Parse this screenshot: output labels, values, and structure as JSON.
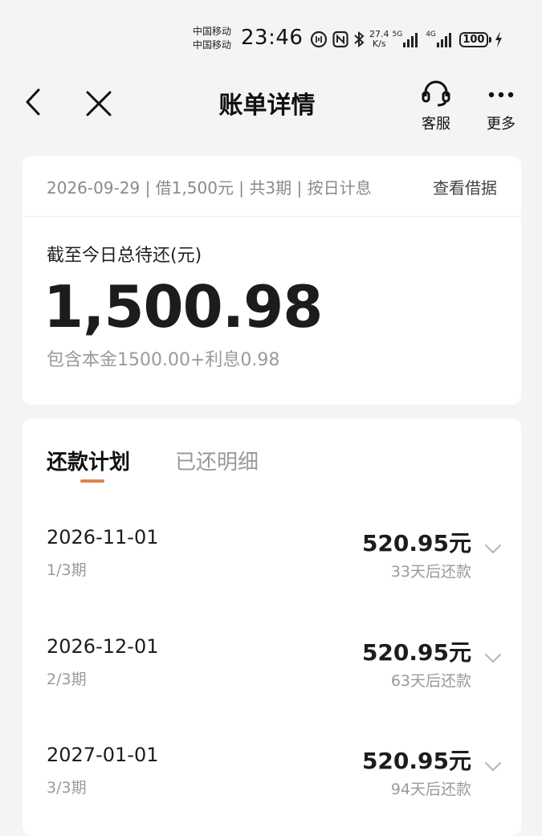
{
  "status_bar": {
    "carrier_1": "中国移动",
    "carrier_2": "中国移动",
    "time": "23:46",
    "net_speed_value": "27.4",
    "net_speed_unit": "K/s",
    "signal_1_label": "5G",
    "signal_2_label": "4G",
    "battery": "100"
  },
  "header": {
    "title": "账单详情",
    "service_label": "客服",
    "more_label": "更多"
  },
  "summary": {
    "loan_info": "2026-09-29 | 借1,500元 | 共3期 | 按日计息",
    "view_receipt": "查看借据",
    "total_label": "截至今日总待还(元)",
    "total_amount": "1,500.98",
    "breakdown": "包含本金1500.00+利息0.98"
  },
  "tabs": {
    "plan": "还款计划",
    "history": "已还明细"
  },
  "plan_items": [
    {
      "date": "2026-11-01",
      "period": "1/3期",
      "amount": "520.95元",
      "due": "33天后还款"
    },
    {
      "date": "2026-12-01",
      "period": "2/3期",
      "amount": "520.95元",
      "due": "63天后还款"
    },
    {
      "date": "2027-01-01",
      "period": "3/3期",
      "amount": "520.95元",
      "due": "94天后还款"
    }
  ],
  "colors": {
    "accent": "#d9874a",
    "background": "#f4f4f6",
    "card": "#ffffff",
    "muted_text": "#9a9a9a"
  },
  "icons": {
    "back": "chevron-left-icon",
    "close": "close-icon",
    "service": "headset-icon",
    "more": "more-dots-icon",
    "expand": "chevron-down-icon"
  }
}
